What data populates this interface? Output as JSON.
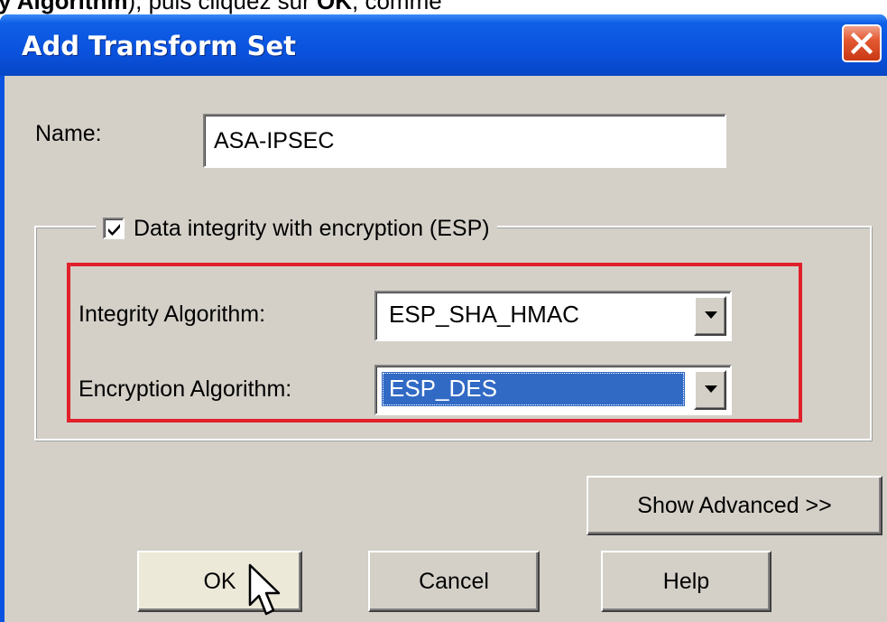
{
  "caption": {
    "part1": "y Algorithm",
    "part2": "), puis cliquez sur ",
    "part3": "OK",
    "part4": ", comme"
  },
  "window": {
    "title": "Add Transform Set",
    "close_icon": "close-x-icon",
    "titlebar_color": "#0a52de",
    "close_color": "#e35a32"
  },
  "form": {
    "name_label": "Name:",
    "name_value": "ASA-IPSEC",
    "group_label": "Data integrity with encryption (ESP)",
    "group_checked": true,
    "integrity_label": "Integrity Algorithm:",
    "integrity_value": "ESP_SHA_HMAC",
    "encryption_label": "Encryption Algorithm:",
    "encryption_value": "ESP_DES",
    "highlight_color": "#e0202a"
  },
  "buttons": {
    "show_advanced": "Show Advanced >>",
    "ok": "OK",
    "cancel": "Cancel",
    "help": "Help"
  }
}
